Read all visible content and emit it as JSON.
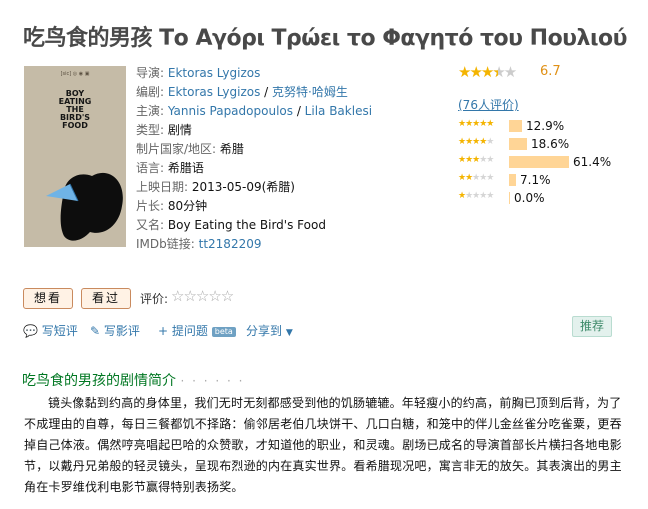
{
  "title": "吃鸟食的男孩 Το Αγόρι Τρώει το Φαγητό του Πουλιού",
  "poster": {
    "title_text": "BOY EATING THE BIRD'S FOOD",
    "logos": "[sic]  ◎  ◉  ▣"
  },
  "info": {
    "director_label": "导演:",
    "director": "Ektoras Lygizos",
    "writer_label": "编剧:",
    "writer_1": "Ektoras Lygizos",
    "writer_2": "克努特·哈姆生",
    "cast_label": "主演:",
    "cast_1": "Yannis Papadopoulos",
    "cast_2": "Lila Baklesi",
    "separator": " / ",
    "genre_label": "类型:",
    "genre": "剧情",
    "country_label": "制片国家/地区:",
    "country": "希腊",
    "language_label": "语言:",
    "language": "希腊语",
    "release_label": "上映日期:",
    "release": "2013-05-09(希腊)",
    "runtime_label": "片长:",
    "runtime": "80分钟",
    "aka_label": "又名:",
    "aka": "Boy Eating the Bird's Food",
    "imdb_label": "IMDb链接:",
    "imdb": "tt2182209"
  },
  "rating": {
    "score": "6.7",
    "stars_value": 3.5,
    "votes_text": "(76人评价)",
    "distribution": [
      {
        "stars": 5,
        "percent": 12.9,
        "label": "12.9%"
      },
      {
        "stars": 4,
        "percent": 18.6,
        "label": "18.6%"
      },
      {
        "stars": 3,
        "percent": 61.4,
        "label": "61.4%"
      },
      {
        "stars": 2,
        "percent": 7.1,
        "label": "7.1%"
      },
      {
        "stars": 1,
        "percent": 0.0,
        "label": "0.0%"
      }
    ],
    "star_color": "#f4b400",
    "bar_color": "#ffd596"
  },
  "buttons": {
    "want": "想看",
    "seen": "看过",
    "my_rating_label": "评价:",
    "my_stars": "☆☆☆☆☆"
  },
  "actions": {
    "short_review": "写短评",
    "review": "写影评",
    "question": "提问题",
    "beta": "beta",
    "share": "分享到",
    "recommend": "推荐"
  },
  "synopsis": {
    "heading": "吃鸟食的男孩的剧情简介",
    "dots": "· · · · · ·",
    "text": "镜头像黏到约高的身体里，我们无时无刻都感受到他的饥肠辘辘。年轻瘦小的约高，前胸已顶到后背，为了不成理由的自尊，每日三餐都饥不择路：偷邻居老伯几块饼干、几口白糖，和笼中的伴儿金丝雀分吃雀粟，更吞掉自己体液。偶然哼亮唱起巴哈的众赞歌，才知道他的职业，和灵魂。剧场已成名的导演首部长片横扫各地电影节，以戴丹兄弟般的轻灵镜头，呈现布烈逊的内在真实世界。看希腊现况吧，寓言非无的放矢。其表演出的男主角在卡罗维伐利电影节赢得特别表扬奖。"
  }
}
